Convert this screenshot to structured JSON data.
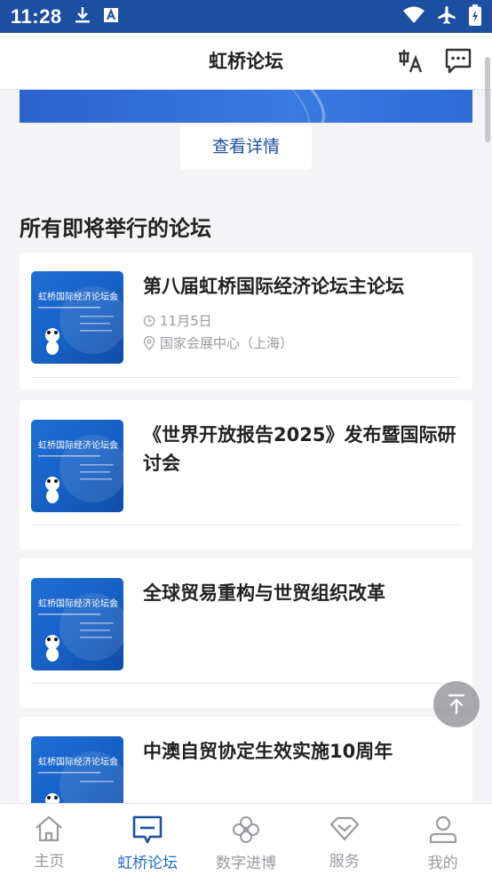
{
  "status_bar": {
    "time": "11:28"
  },
  "header": {
    "title": "虹桥论坛"
  },
  "banner": {
    "detail_button": "查看详情"
  },
  "section": {
    "title": "所有即将举行的论坛"
  },
  "forums": [
    {
      "title": "第八届虹桥国际经济论坛主论坛",
      "date": "11月5日",
      "location": "国家会展中心（上海）"
    },
    {
      "title": "《世界开放报告2025》发布暨国际研讨会"
    },
    {
      "title": "全球贸易重构与世贸组织改革"
    },
    {
      "title": "中澳自贸协定生效实施10周年"
    }
  ],
  "thumb": {
    "text": "虹桥国际经济论坛会"
  },
  "tabs": [
    {
      "label": "主页",
      "icon": "home-icon"
    },
    {
      "label": "虹桥论坛",
      "icon": "forum-icon"
    },
    {
      "label": "数字进博",
      "icon": "clover-icon"
    },
    {
      "label": "服务",
      "icon": "diamond-icon"
    },
    {
      "label": "我的",
      "icon": "person-icon"
    }
  ],
  "colors": {
    "brand": "#1c4fa0",
    "active_tab": "#1c6fc4",
    "muted": "#9a9aa0"
  }
}
